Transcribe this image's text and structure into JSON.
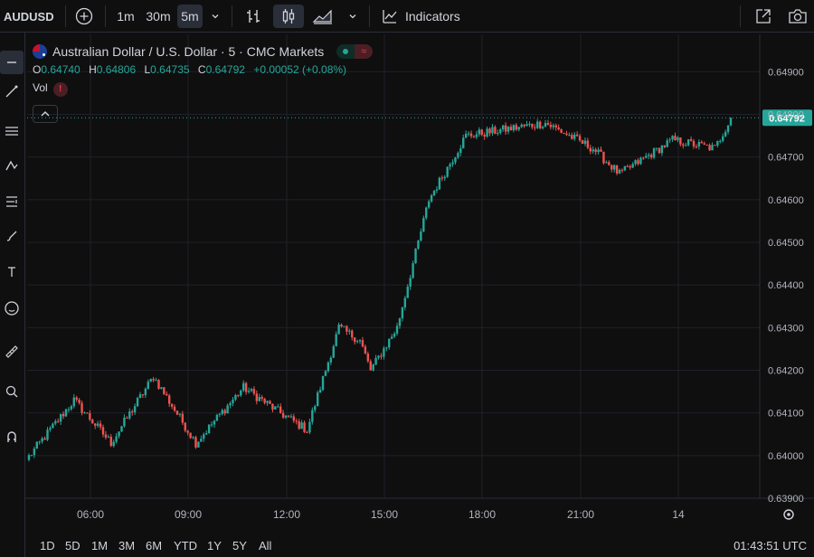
{
  "toolbar": {
    "symbol": "AUDUSD",
    "intervals": [
      "1m",
      "30m",
      "5m"
    ],
    "selected_interval": "5m",
    "indicators_label": "Indicators"
  },
  "legend": {
    "title": "Australian Dollar / U.S. Dollar · 5 · CMC Markets",
    "open_label": "O",
    "open": "0.64740",
    "high_label": "H",
    "high": "0.64806",
    "low_label": "L",
    "low": "0.64735",
    "close_label": "C",
    "close": "0.64792",
    "change": "+0.00052 (+0.08%)",
    "vol_label": "Vol",
    "vol_warning": "!",
    "status_colors": [
      "#26a69a",
      "#f23645"
    ]
  },
  "bottombar": {
    "ranges": [
      "1D",
      "5D",
      "1M",
      "3M",
      "6M",
      "YTD",
      "1Y",
      "5Y",
      "All"
    ],
    "clock": "01:43:51 UTC"
  },
  "chart_data": {
    "type": "candlestick",
    "y_ticks": [
      "0.64900",
      "0.64800",
      "0.64700",
      "0.64600",
      "0.64500",
      "0.64400",
      "0.64300",
      "0.64200",
      "0.64100",
      "0.64000",
      "0.63900"
    ],
    "x_ticks": [
      "06:00",
      "09:00",
      "12:00",
      "15:00",
      "18:00",
      "21:00",
      "14"
    ],
    "ylim": [
      0.639,
      0.64905
    ],
    "last_price": "0.64792",
    "colors": {
      "up": "#26a69a",
      "down": "#ef5350",
      "grid": "#1e2128",
      "price_label": "#26a69a"
    },
    "grid": true,
    "segments": [
      {
        "n": 18,
        "start": 0.6399,
        "end": 0.6413
      },
      {
        "n": 14,
        "start": 0.6413,
        "end": 0.6403
      },
      {
        "n": 16,
        "start": 0.6403,
        "end": 0.64185
      },
      {
        "n": 16,
        "start": 0.64185,
        "end": 0.6403
      },
      {
        "n": 18,
        "start": 0.6403,
        "end": 0.6416
      },
      {
        "n": 14,
        "start": 0.6416,
        "end": 0.641
      },
      {
        "n": 10,
        "start": 0.641,
        "end": 0.6406
      },
      {
        "n": 12,
        "start": 0.6406,
        "end": 0.643
      },
      {
        "n": 8,
        "start": 0.643,
        "end": 0.6427
      },
      {
        "n": 4,
        "start": 0.6427,
        "end": 0.642
      },
      {
        "n": 10,
        "start": 0.642,
        "end": 0.643
      },
      {
        "n": 12,
        "start": 0.643,
        "end": 0.646
      },
      {
        "n": 14,
        "start": 0.646,
        "end": 0.6475
      },
      {
        "n": 30,
        "start": 0.6475,
        "end": 0.6478
      },
      {
        "n": 18,
        "start": 0.6478,
        "end": 0.6472
      },
      {
        "n": 10,
        "start": 0.6472,
        "end": 0.6466
      },
      {
        "n": 20,
        "start": 0.6466,
        "end": 0.6474
      },
      {
        "n": 16,
        "start": 0.6474,
        "end": 0.6472
      },
      {
        "n": 6,
        "start": 0.6472,
        "end": 0.64792
      }
    ]
  }
}
